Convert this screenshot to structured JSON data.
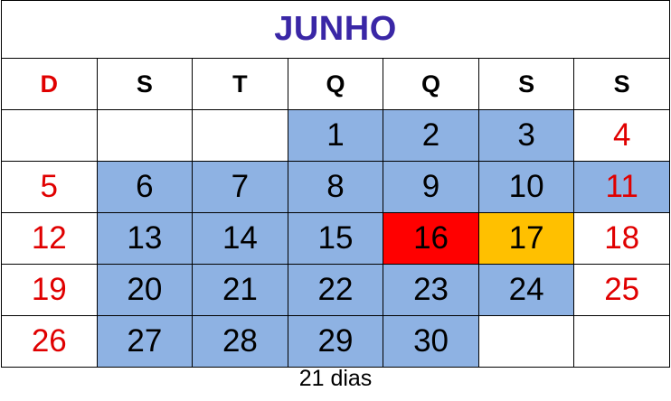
{
  "calendar": {
    "month": "JUNHO",
    "weekdays": [
      "D",
      "S",
      "T",
      "Q",
      "Q",
      "S",
      "S"
    ],
    "weeks": [
      [
        {
          "day": "",
          "style": "empty"
        },
        {
          "day": "",
          "style": "empty"
        },
        {
          "day": "",
          "style": "empty"
        },
        {
          "day": "1",
          "style": "workday"
        },
        {
          "day": "2",
          "style": "workday"
        },
        {
          "day": "3",
          "style": "workday"
        },
        {
          "day": "4",
          "style": "weekend"
        }
      ],
      [
        {
          "day": "5",
          "style": "weekend"
        },
        {
          "day": "6",
          "style": "workday"
        },
        {
          "day": "7",
          "style": "workday"
        },
        {
          "day": "8",
          "style": "workday"
        },
        {
          "day": "9",
          "style": "workday"
        },
        {
          "day": "10",
          "style": "workday"
        },
        {
          "day": "11",
          "style": "weekend-highlighted"
        }
      ],
      [
        {
          "day": "12",
          "style": "weekend"
        },
        {
          "day": "13",
          "style": "workday"
        },
        {
          "day": "14",
          "style": "workday"
        },
        {
          "day": "15",
          "style": "workday"
        },
        {
          "day": "16",
          "style": "red-highlight"
        },
        {
          "day": "17",
          "style": "orange-highlight"
        },
        {
          "day": "18",
          "style": "weekend"
        }
      ],
      [
        {
          "day": "19",
          "style": "weekend"
        },
        {
          "day": "20",
          "style": "workday"
        },
        {
          "day": "21",
          "style": "workday"
        },
        {
          "day": "22",
          "style": "workday"
        },
        {
          "day": "23",
          "style": "workday"
        },
        {
          "day": "24",
          "style": "workday"
        },
        {
          "day": "25",
          "style": "weekend"
        }
      ],
      [
        {
          "day": "26",
          "style": "weekend"
        },
        {
          "day": "27",
          "style": "workday"
        },
        {
          "day": "28",
          "style": "workday"
        },
        {
          "day": "29",
          "style": "workday"
        },
        {
          "day": "30",
          "style": "workday"
        },
        {
          "day": "",
          "style": "empty"
        },
        {
          "day": "",
          "style": "empty"
        }
      ]
    ],
    "footer": "21 dias"
  },
  "colors": {
    "title": "#3a27a6",
    "weekend_text": "#e00000",
    "workday_fill": "#8eb2e3",
    "red_highlight_fill": "#ff0000",
    "orange_highlight_fill": "#ffc000",
    "border": "#000000"
  }
}
